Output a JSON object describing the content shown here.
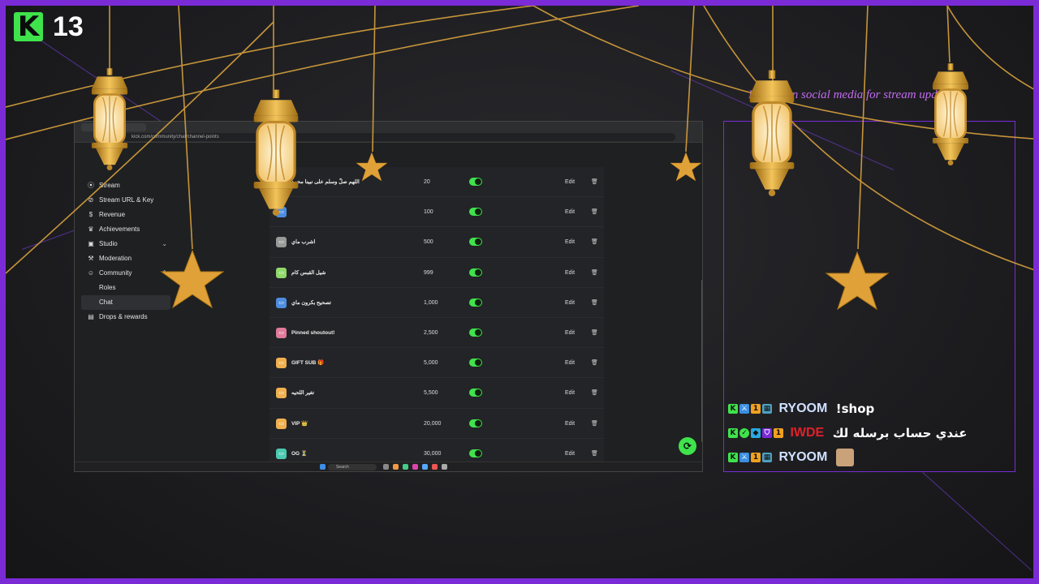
{
  "overlay": {
    "viewer_count": "13",
    "platform_logo": "K",
    "social_note": "Follow on social media for stream updates",
    "accent": "#7a2bd6",
    "brand_green": "#3fe34b"
  },
  "browser": {
    "url": "kick.com/community/chat/channel-points"
  },
  "sidebar": {
    "items": [
      {
        "label": "Stream",
        "icon": "broadcast-icon"
      },
      {
        "label": "Stream URL & Key",
        "icon": "link-icon"
      },
      {
        "label": "Revenue",
        "icon": "dollar-icon"
      },
      {
        "label": "Achievements",
        "icon": "trophy-icon"
      },
      {
        "label": "Studio",
        "icon": "studio-icon"
      },
      {
        "label": "Moderation",
        "icon": "gavel-icon"
      },
      {
        "label": "Community",
        "icon": "people-icon"
      },
      {
        "label": "Roles",
        "icon": ""
      },
      {
        "label": "Chat",
        "icon": ""
      },
      {
        "label": "Drops & rewards",
        "icon": "gift-icon"
      }
    ]
  },
  "rewards": {
    "edit_label": "Edit",
    "rows": [
      {
        "name": "اللهم صلّ وسلم على نبينا محمد",
        "cost": "20",
        "color": "#4d8de0"
      },
      {
        "name": "",
        "cost": "100",
        "color": "#4d8de0"
      },
      {
        "name": "اشرب ماي",
        "cost": "500",
        "color": "#999999"
      },
      {
        "name": "شيل القبس كام",
        "cost": "999",
        "color": "#8fd96a"
      },
      {
        "name": "تصحيح بكرون ماي",
        "cost": "1,000",
        "color": "#4d8de0"
      },
      {
        "name": "Pinned shoutout!",
        "cost": "2,500",
        "color": "#e07a9a"
      },
      {
        "name": "GIFT SUB 🎁",
        "cost": "5,000",
        "color": "#f0b050"
      },
      {
        "name": "تغير اللحيه",
        "cost": "5,500",
        "color": "#f0b050"
      },
      {
        "name": "VIP 👑",
        "cost": "20,000",
        "color": "#f0b050"
      },
      {
        "name": "OG ⏳",
        "cost": "30,000",
        "color": "#4dc9b0"
      }
    ]
  },
  "taskbar": {
    "search_placeholder": "Search"
  },
  "chat": {
    "messages": [
      {
        "username": "RYOOM",
        "name_color": "#cfe0ff",
        "text": "!shop",
        "emote": false
      },
      {
        "username": "IWDE",
        "name_color": "#e0202a",
        "text": "عندي حساب برسله لك",
        "emote": false
      },
      {
        "username": "RYOOM",
        "name_color": "#cfe0ff",
        "text": "",
        "emote": true
      }
    ]
  }
}
